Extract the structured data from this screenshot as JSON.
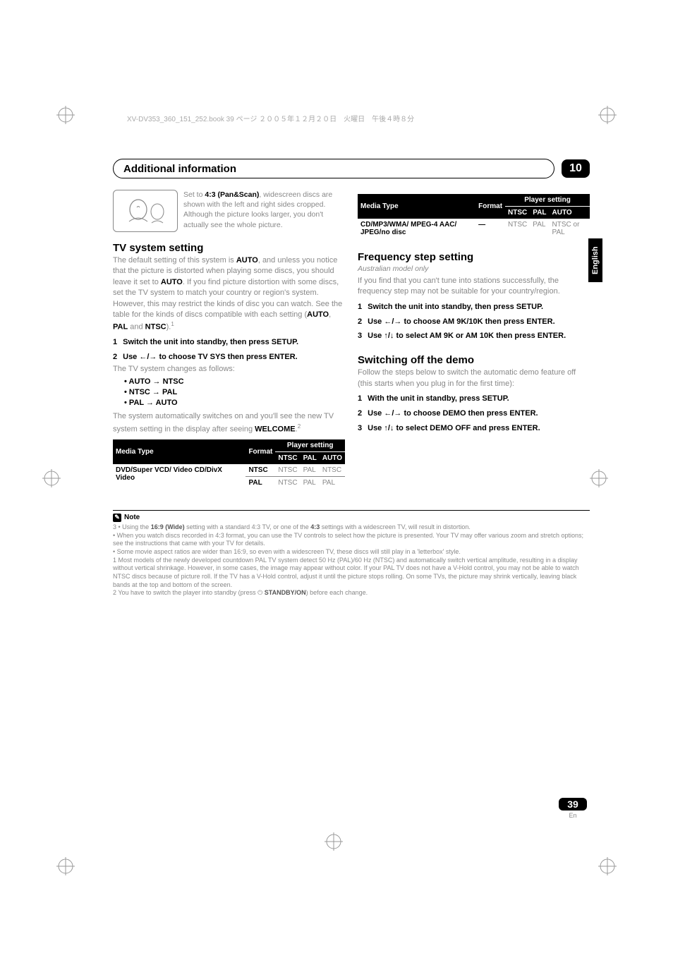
{
  "doc_header_meta": "XV-DV353_360_151_252.book 39 ページ ２００５年１２月２０日　火曜日　午後４時８分",
  "chapter": {
    "title": "Additional information",
    "number": "10"
  },
  "side_tab": "English",
  "panscan": {
    "prefix": "Set to ",
    "bold": "4:3 (Pan&Scan)",
    "suffix": ", widescreen discs are shown with the left and right sides cropped. Although the picture looks larger, you don't actually see the whole picture."
  },
  "sections": {
    "tv_system": {
      "heading": "TV system setting",
      "para_pre": "The default setting of this system is ",
      "para_bold1": "AUTO",
      "para_mid1": ", and unless you notice that the picture is distorted when playing some discs, you should leave it set to ",
      "para_bold2": "AUTO",
      "para_mid2": ". If you find picture distortion with some discs, set the TV system to match your country or region's system. However, this may restrict the kinds of disc you can watch. See the table for the kinds of discs compatible with each setting (",
      "para_bold3": "AUTO",
      "para_comma": ", ",
      "para_bold4": "PAL",
      "para_and": " and ",
      "para_bold5": "NTSC",
      "para_end": ").",
      "sup1": "1",
      "step1": "Switch the unit into standby, then press SETUP.",
      "step2_pre": "Use ",
      "step2_arrows": "←/→",
      "step2_post": " to choose TV SYS then press ENTER.",
      "tv_changes": "The TV system changes as follows:",
      "bullets": [
        "AUTO → NTSC",
        "NTSC → PAL",
        "PAL → AUTO"
      ],
      "after_para_pre": "The system automatically switches on and you'll see the new TV system setting in the display after seeing ",
      "after_bold": "WELCOME",
      "after_dot": ".",
      "sup2": "2"
    },
    "frequency": {
      "heading": "Frequency step setting",
      "subtitle": "Australian model only",
      "para": "If you find that you can't tune into stations successfully, the frequency step may not be suitable for your country/region.",
      "step1": "Switch the unit into standby, then press SETUP.",
      "step2_pre": "Use ",
      "step2_arrows": "←/→",
      "step2_post": " to choose AM 9K/10K then press ENTER.",
      "step3_pre": "Use ",
      "step3_arrows": "↑/↓",
      "step3_post": " to select AM 9K or AM 10K  then press ENTER."
    },
    "demo": {
      "heading": "Switching off the demo",
      "para": "Follow the steps below to switch the automatic demo feature off (this starts when you plug in for the first time):",
      "step1": "With the unit in standby, press SETUP.",
      "step2_pre": "Use ",
      "step2_arrows": "←/→",
      "step2_post": " to choose DEMO then press ENTER.",
      "step3_pre": "Use ",
      "step3_arrows": "↑/↓",
      "step3_post": " to select DEMO OFF and press ENTER."
    }
  },
  "tables": {
    "head_group": "Player setting",
    "head_media": "Media Type",
    "head_format": "Format",
    "head_ntsc": "NTSC",
    "head_pal": "PAL",
    "head_auto": "AUTO",
    "left": {
      "row1_label": "DVD/Super VCD/ Video CD/DivX Video",
      "r1_format": "NTSC",
      "r1_ntsc": "NTSC",
      "r1_pal": "PAL",
      "r1_auto": "NTSC",
      "r2_format": "PAL",
      "r2_ntsc": "NTSC",
      "r2_pal": "PAL",
      "r2_auto": "PAL"
    },
    "right": {
      "row_label": "CD/MP3/WMA/ MPEG-4 AAC/ JPEG/no disc",
      "format": "—",
      "ntsc": "NTSC",
      "pal": "PAL",
      "auto": "NTSC or PAL"
    }
  },
  "note": {
    "label": "Note",
    "l1_pre": "3 • Using the ",
    "l1_b1": "16:9 (Wide)",
    "l1_mid": " setting with a standard 4:3 TV, or one of the ",
    "l1_b2": "4:3",
    "l1_post": " settings with a widescreen TV, will result in distortion.",
    "l2": "• When you watch discs recorded in 4:3 format, you can use the TV controls to select how the picture is presented. Your TV may offer various zoom and stretch options; see the instructions that came with your TV for details.",
    "l3": "• Some movie aspect ratios are wider than 16:9, so even with a widescreen TV, these discs will still play in a 'letterbox' style.",
    "l4": "1 Most models of the newly developed countdown PAL TV system detect 50 Hz (PAL)/60 Hz (NTSC) and automatically switch vertical amplitude, resulting in a display without vertical shrinkage. However, in some cases, the image may appear without color. If your PAL TV does not have a V-Hold control, you may not be able to watch NTSC discs because of picture roll. If the TV has a V-Hold control, adjust it until the picture stops rolling. On some TVs, the picture may shrink vertically, leaving black bands at the top and bottom of the screen.",
    "l5_pre": "2 You have to switch the player into standby (press ",
    "l5_icon": "⏻",
    "l5_b": "STANDBY/ON",
    "l5_post": ") before each change."
  },
  "page": {
    "number": "39",
    "lang": "En"
  }
}
